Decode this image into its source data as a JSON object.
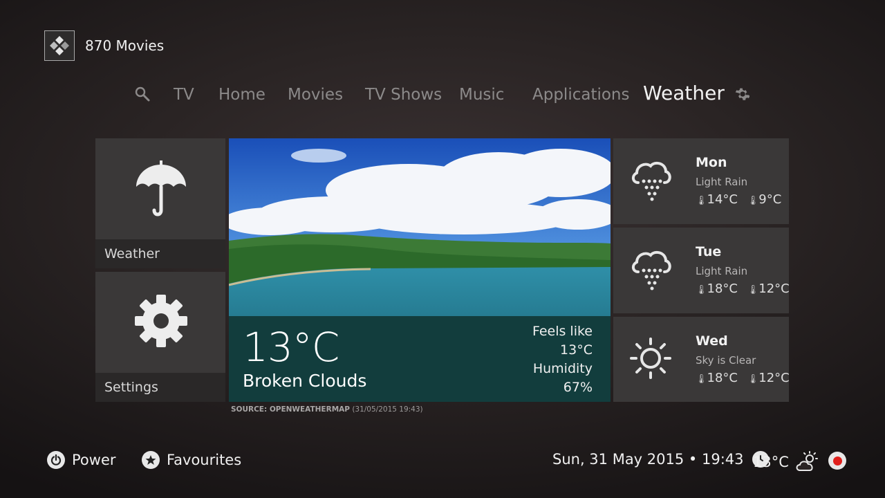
{
  "header": {
    "app_title": "870 Movies",
    "logo_icon": "kodi-logo-icon"
  },
  "nav": {
    "search_icon": "search-icon",
    "items": [
      "TV",
      "Home",
      "Movies",
      "TV Shows",
      "Music",
      "Applications",
      "Weather"
    ],
    "active": "Weather",
    "settings_icon": "gear-icon"
  },
  "tiles": {
    "weather": {
      "label": "Weather",
      "icon": "umbrella-icon"
    },
    "settings": {
      "label": "Settings",
      "icon": "gear-icon"
    }
  },
  "current": {
    "temp": "13°C",
    "condition": "Broken Clouds",
    "feels_like_label": "Feels like",
    "feels_like_value": "13°C",
    "humidity_label": "Humidity",
    "humidity_value": "67%",
    "source_label": "SOURCE: OPENWEATHERMAP",
    "source_time": "(31/05/2015 19:43)"
  },
  "forecast": [
    {
      "day": "Mon",
      "condition": "Light Rain",
      "high": "14°C",
      "low": "9°C",
      "icon": "rain-cloud-icon"
    },
    {
      "day": "Tue",
      "condition": "Light Rain",
      "high": "18°C",
      "low": "12°C",
      "icon": "rain-cloud-icon"
    },
    {
      "day": "Wed",
      "condition": "Sky is Clear",
      "high": "18°C",
      "low": "12°C",
      "icon": "sun-icon"
    }
  ],
  "bottom": {
    "power_label": "Power",
    "favourites_label": "Favourites",
    "datetime": "Sun, 31 May 2015 • 19:43",
    "temp": "13°C",
    "clock_icon": "clock-icon",
    "weather_icon": "partly-cloudy-icon",
    "record_icon": "record-icon"
  },
  "colors": {
    "accent_record": "#e0201c",
    "tile_bg": "#3a3838",
    "label_bar": "#2a2828"
  }
}
